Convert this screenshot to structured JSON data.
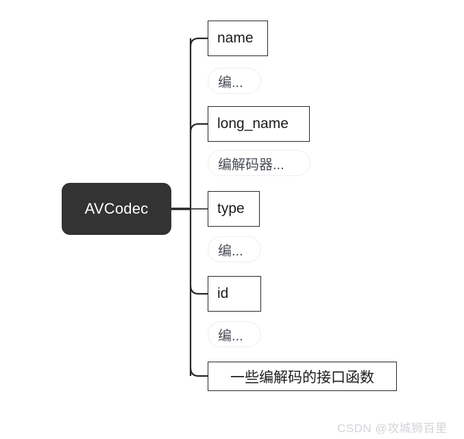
{
  "diagram": {
    "type": "mindmap-tree",
    "orientation": "left-to-right",
    "root": {
      "label": "AVCodec",
      "fill": "#333333",
      "text_color": "#ffffff"
    },
    "branch_color": "#262626",
    "children": [
      {
        "label": "name",
        "kind": "box",
        "child": {
          "label": "编...",
          "kind": "pill"
        }
      },
      {
        "label": "long_name",
        "kind": "box",
        "child": {
          "label": "编解码器...",
          "kind": "pill"
        }
      },
      {
        "label": "type",
        "kind": "box",
        "child": {
          "label": "编...",
          "kind": "pill"
        }
      },
      {
        "label": "id",
        "kind": "box",
        "child": {
          "label": "编...",
          "kind": "pill"
        }
      },
      {
        "label": "一些编解码的接口函数",
        "kind": "box",
        "child": null
      }
    ]
  },
  "watermark": {
    "text": "CSDN @攻城狮百里",
    "color": "#d2d4d8"
  }
}
